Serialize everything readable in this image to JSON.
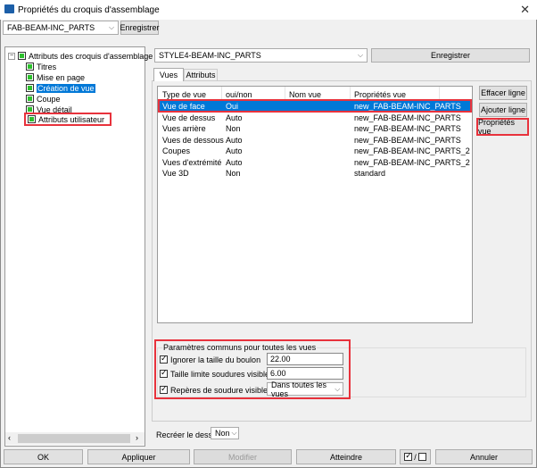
{
  "window": {
    "title": "Propriétés du croquis d'assemblage",
    "close": "✕"
  },
  "top": {
    "preset": "FAB-BEAM-INC_PARTS",
    "save": "Enregistrer"
  },
  "tree": {
    "root": "Attributs des croquis d'assemblage",
    "items": [
      "Titres",
      "Mise en page",
      "Création de vue",
      "Coupe",
      "Vue détail",
      "Attributs utilisateur"
    ]
  },
  "right": {
    "preset": "STYLE4-BEAM-INC_PARTS",
    "save": "Enregistrer"
  },
  "tabs": [
    "Vues",
    "Attributs"
  ],
  "table": {
    "headers": [
      "Type de vue",
      "oui/non",
      "Nom vue",
      "Propriétés vue"
    ],
    "rows": [
      [
        "Vue de face",
        "Oui",
        "",
        "new_FAB-BEAM-INC_PARTS"
      ],
      [
        "Vue de dessus",
        "Auto",
        "",
        "new_FAB-BEAM-INC_PARTS"
      ],
      [
        "Vues arrière",
        "Non",
        "",
        "new_FAB-BEAM-INC_PARTS"
      ],
      [
        "Vues de dessous",
        "Auto",
        "",
        "new_FAB-BEAM-INC_PARTS"
      ],
      [
        "Coupes",
        "Auto",
        "",
        "new_FAB-BEAM-INC_PARTS_2"
      ],
      [
        "Vues d'extrémité",
        "Auto",
        "",
        "new_FAB-BEAM-INC_PARTS_2"
      ],
      [
        "Vue 3D",
        "Non",
        "",
        "standard"
      ]
    ]
  },
  "side_buttons": {
    "clear": "Effacer ligne",
    "add": "Ajouter ligne",
    "props": "Propriétés vue"
  },
  "common": {
    "title": "Paramètres communs pour toutes les vues",
    "ignore_label": "Ignorer la taille du boulon",
    "ignore_value": "22.00",
    "limit_label": "Taille limite soudures visibles",
    "limit_value": "6.00",
    "marks_label": "Repères de soudure visibles :",
    "marks_value": "Dans toutes les vues"
  },
  "recreate": {
    "label": "Recréer le dessin",
    "value": "Non"
  },
  "bottom": {
    "ok": "OK",
    "apply": "Appliquer",
    "modify": "Modifier",
    "goto": "Atteindre",
    "toggle": "/",
    "cancel": "Annuler"
  }
}
